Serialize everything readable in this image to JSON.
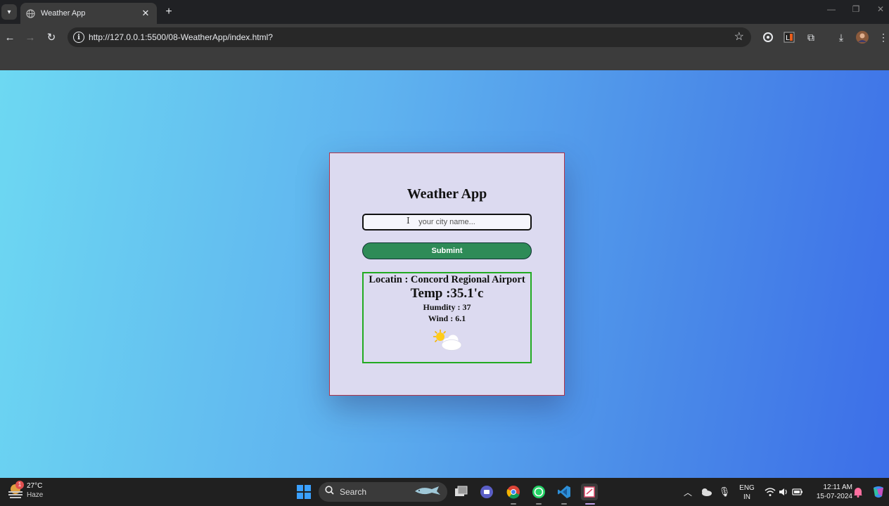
{
  "browser": {
    "tab_title": "Weather App",
    "url": "http://127.0.0.1:5500/08-WeatherApp/index.html?"
  },
  "app": {
    "title": "Weather App",
    "input_placeholder": "your city name...",
    "submit_label": "Submint",
    "location_text": "Locatin : Concord Regional Airport",
    "temp_text": "Temp :35.1'c",
    "humidity_text": "Humdity : 37",
    "wind_text": "Wind : 6.1",
    "weather_icon": "partly-cloudy-icon"
  },
  "taskbar": {
    "weather_temp": "27°C",
    "weather_cond": "Haze",
    "weather_badge": "1",
    "search_label": "Search",
    "lang_1": "ENG",
    "lang_2": "IN",
    "time": "12:11 AM",
    "date": "15-07-2024"
  },
  "colors": {
    "card_bg": "#dcdaf0",
    "submit_bg": "#2e8b57",
    "result_border": "#22aa22",
    "gradient_start": "#6dd8f2",
    "gradient_end": "#3c6ee8"
  }
}
